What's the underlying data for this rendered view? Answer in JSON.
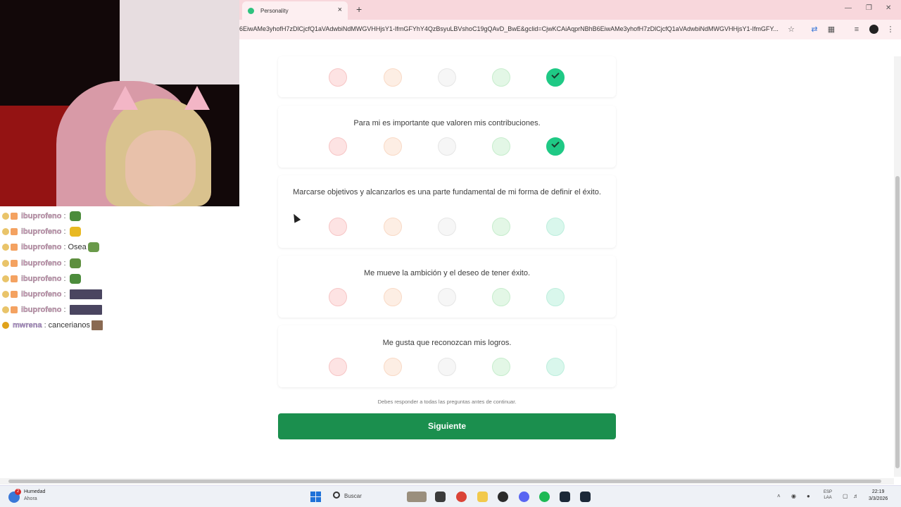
{
  "browser": {
    "tab_title": "Personality",
    "url": "6EiwAMe3yhofH7zDlCjcfQ1aVAdwbiNdMWGVHHjsY1-IfmGFYhY4QzBsyuLBVshoC19gQAvD_BwE&gclid=CjwKCAiAqprNBhB6EiwAMe3yhofH7zDlCjcfQ1aVAdwbiNdMWGVHHjsY1-IfmGFY...",
    "new_tab": "+",
    "close_tab": "×"
  },
  "questions": [
    {
      "text": "",
      "selected": 5
    },
    {
      "text": "Para mi es importante que valoren mis contribuciones.",
      "selected": 5
    },
    {
      "text": "Marcarse objetivos y alcanzarlos es una parte fundamental de mi forma de definir el éxito.",
      "selected": 0
    },
    {
      "text": "Me mueve la ambición y el deseo de tener éxito.",
      "selected": 0
    },
    {
      "text": "Me gusta que reconozcan mis logros.",
      "selected": 0
    }
  ],
  "form": {
    "note": "Debes responder a todas las preguntas antes de continuar.",
    "next_label": "Siguiente"
  },
  "chat": [
    {
      "user": "ibuprofeno",
      "sep": ":",
      "msg": "",
      "emote": "pepe-green"
    },
    {
      "user": "ibuprofeno",
      "sep": ":",
      "msg": "",
      "emote": "wave-yellow"
    },
    {
      "user": "ibuprofeno",
      "sep": ":",
      "msg": "Osea",
      "emote": "pepe-green"
    },
    {
      "user": "ibuprofeno",
      "sep": ":",
      "msg": "",
      "emote": "frog-small"
    },
    {
      "user": "ibuprofeno",
      "sep": ":",
      "msg": "",
      "emote": "pepe-green"
    },
    {
      "user": "ibuprofeno",
      "sep": ":",
      "msg": "",
      "emote": "clip-image"
    },
    {
      "user": "ibuprofeno",
      "sep": ":",
      "msg": "",
      "emote": "clip-image"
    },
    {
      "user": "mwrena",
      "sep": ":",
      "msg": "cancerianos",
      "emote": "portrait"
    }
  ],
  "taskbar": {
    "weather_title": "Humedad",
    "weather_sub": "Ahora",
    "weather_badge": "2",
    "search_label": "Buscar",
    "lang_top": "ESP",
    "lang_bottom": "LAA",
    "time": "22:19",
    "date": "3/3/2026"
  },
  "colors": {
    "accent": "#1b8f4e",
    "selected_option": "#1fc985",
    "tab_bar": "#f8d7dc"
  }
}
